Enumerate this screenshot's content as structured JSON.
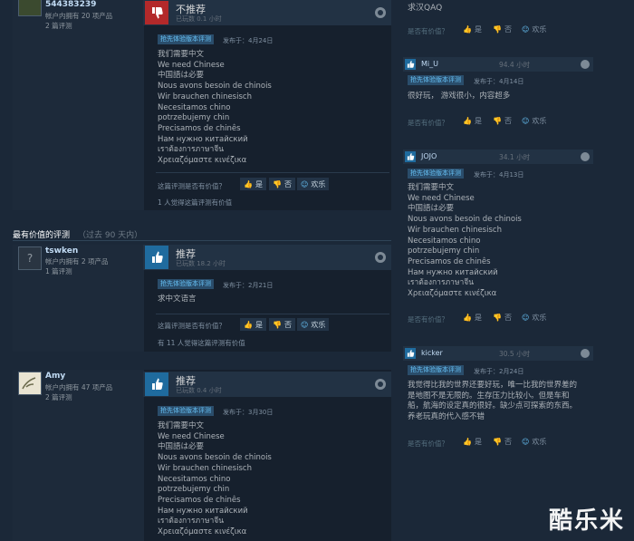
{
  "reviews": [
    {
      "author": "544383239",
      "owned": "帐户内拥有 20 项产品",
      "count": "2 篇评测",
      "verdict": "不推荐",
      "hours": "已玩数 0.1 小时",
      "badge": "抢先体验版本评测",
      "posted": "发布于：4月24日",
      "body": "我们需要中文\nWe need Chinese\n中国語は必要\nNous avons besoin de chinois\nWir brauchen chinesisch\nNecesitamos chino\npotrzebujemy chin\nPrecisamos de chinês\nНам нужно китайский\nเราต้องการภาษาจีน\nΧρειαζόμαστε κινέζικα",
      "helpful_q": "这篇评测是否有价值？",
      "yes": "是",
      "no": "否",
      "funny": "欢乐",
      "found": "1 人觉得这篇评测有价值"
    },
    {
      "author": "tswken",
      "owned": "帐户内拥有 2 项产品",
      "count": "1 篇评测",
      "verdict": "推荐",
      "hours": "已玩数 18.2 小时",
      "badge": "抢先体验版本评测",
      "posted": "发布于：2月21日",
      "body": "求中文语言",
      "helpful_q": "这篇评测是否有价值？",
      "yes": "是",
      "no": "否",
      "funny": "欢乐",
      "found": "有 11 人觉得这篇评测有价值"
    },
    {
      "author": "Amy",
      "owned": "帐户内拥有 47 项产品",
      "count": "2 篇评测",
      "verdict": "推荐",
      "hours": "已玩数 0.4 小时",
      "badge": "抢先体验版本评测",
      "posted": "发布于：3月30日",
      "body": "我们需要中文\nWe need Chinese\n中国語は必要\nNous avons besoin de chinois\nWir brauchen chinesisch\nNecesitamos chino\npotrzebujemy chin\nPrecisamos de chinês\nНам нужно китайский\nเราต้องการภาษาจีน\nΧρειαζόμαστε κινέζικα"
    }
  ],
  "section": {
    "title": "最有价值的评测",
    "sub": "（过去 90 天内）"
  },
  "right": {
    "top_text": "求汉QAQ",
    "helpful_q": "是否有价值？",
    "yes": "是",
    "no": "否",
    "funny": "欢乐",
    "cards": [
      {
        "name": "Mi_U",
        "hours": "94.4 小时",
        "badge": "抢先体验版本评测",
        "posted": "发布于：4月14日",
        "body": "很好玩， 游戏很小，内容超多"
      },
      {
        "name": "JOJO",
        "hours": "34.1 小时",
        "badge": "抢先体验版本评测",
        "posted": "发布于：4月13日",
        "body": "我们需要中文\nWe need Chinese\n中国語は必要\nNous avons besoin de chinois\nWir brauchen chinesisch\nNecesitamos chino\npotrzebujemy chin\nPrecisamos de chinês\nНам нужно китайский\nเราต้องการภาษาจีน\nΧρειαζόμαστε κινέζικα"
      },
      {
        "name": "kicker",
        "hours": "30.5 小时",
        "badge": "抢先体验版本评测",
        "posted": "发布于：2月24日",
        "body": "我觉得比我的世界还要好玩，唯一比我的世界差的\n是地图不是无限的。生存压力比较小。但是车和\n船，航海的设定真的很好。缺少点可探索的东西。\n养老玩真的代入感不错"
      }
    ]
  },
  "watermark": "酷乐米",
  "colors": {
    "background": "#1b2838",
    "thumb_down": "#b3292a",
    "thumb_up": "#1f6b9e",
    "link": "#66c0f4"
  }
}
